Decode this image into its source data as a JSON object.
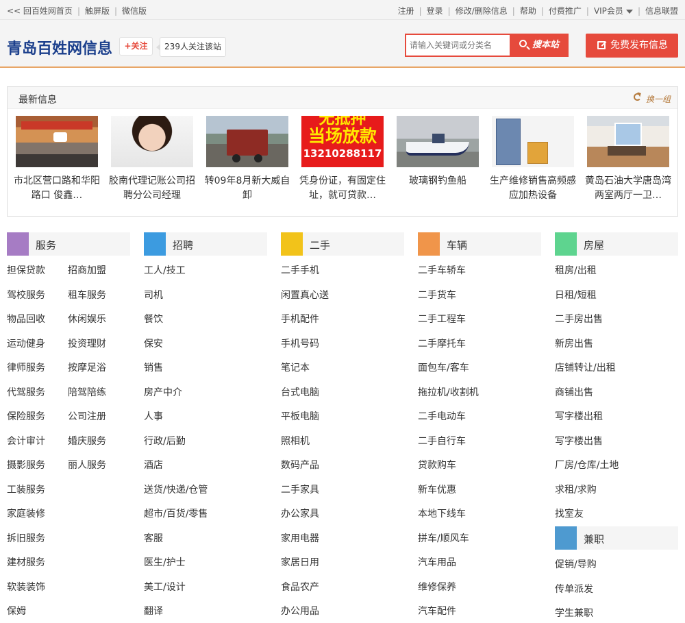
{
  "topbar": {
    "left": [
      {
        "label": "<< 回百姓网首页"
      },
      {
        "label": "触屏版"
      },
      {
        "label": "微信版"
      }
    ],
    "right": [
      {
        "label": "注册"
      },
      {
        "label": "登录"
      },
      {
        "label": "修改/删除信息"
      },
      {
        "label": "帮助"
      },
      {
        "label": "付费推广"
      },
      {
        "label": "VIP会员"
      },
      {
        "label": "信息联盟"
      }
    ]
  },
  "header": {
    "site_title": "青岛百姓网信息",
    "follow_label": "+关注",
    "follow_count": "239人关注该站",
    "search_placeholder": "请输入关键词或分类名",
    "search_button": "搜本站",
    "publish_button": "免费发布信息",
    "accent_color": "#e64a3c"
  },
  "latest": {
    "title": "最新信息",
    "refresh_label": "换一组",
    "items": [
      {
        "caption": "市北区营口路和华阳路口 俊鑫…",
        "image": "storefront-photo"
      },
      {
        "caption": "胶南代理记账公司招聘分公司经理",
        "image": "portrait-photo"
      },
      {
        "caption": "转09年8月新大威自卸",
        "image": "dump-truck-photo"
      },
      {
        "caption": "凭身份证，有固定住址，就可贷款…",
        "image": "loan-ad",
        "ad_lines": [
          "无抵押",
          "当场放款",
          "13210288117"
        ]
      },
      {
        "caption": "玻璃钢钓鱼船",
        "image": "boat-photo"
      },
      {
        "caption": "生产维修销售高频感应加热设备",
        "image": "heater-equipment-photo"
      },
      {
        "caption": "黄岛石油大学唐岛湾两室两厅一卫…",
        "image": "living-room-photo"
      }
    ]
  },
  "categories": [
    {
      "name": "服务",
      "color": "#a67cc4",
      "items": [
        "担保贷款",
        "招商加盟",
        "驾校服务",
        "租车服务",
        "物品回收",
        "休闲娱乐",
        "运动健身",
        "投资理财",
        "律师服务",
        "按摩足浴",
        "代驾服务",
        "陪驾陪练",
        "保险服务",
        "公司注册",
        "会计审计",
        "婚庆服务",
        "摄影服务",
        "丽人服务",
        "工装服务",
        "家庭装修",
        "拆旧服务",
        "建材服务",
        "软装装饰",
        "保姆"
      ]
    },
    {
      "name": "招聘",
      "color": "#3c9be0",
      "items": [
        "工人/技工",
        "司机",
        "餐饮",
        "保安",
        "销售",
        "房产中介",
        "人事",
        "行政/后勤",
        "酒店",
        "送货/快递/仓管",
        "超市/百货/零售",
        "客服",
        "医生/护士",
        "美工/设计",
        "翻译"
      ]
    },
    {
      "name": "二手",
      "color": "#f2c31a",
      "items": [
        "二手手机",
        "闲置真心送",
        "手机配件",
        "手机号码",
        "笔记本",
        "台式电脑",
        "平板电脑",
        "照相机",
        "数码产品",
        "二手家具",
        "办公家具",
        "家用电器",
        "家居日用",
        "食品农产",
        "办公用品"
      ]
    },
    {
      "name": "车辆",
      "color": "#f0954a",
      "items": [
        "二手车轿车",
        "二手货车",
        "二手工程车",
        "二手摩托车",
        "面包车/客车",
        "拖拉机/收割机",
        "二手电动车",
        "二手自行车",
        "贷款购车",
        "新车优惠",
        "本地下线车",
        "拼车/顺风车",
        "汽车用品",
        "维修保养",
        "汽车配件"
      ]
    },
    {
      "name": "房屋",
      "color": "#5ed48f",
      "items": [
        "租房/出租",
        "日租/短租",
        "二手房出售",
        "新房出售",
        "店铺转让/出租",
        "商铺出售",
        "写字楼出租",
        "写字楼出售",
        "厂房/仓库/土地",
        "求租/求购",
        "找室友"
      ]
    },
    {
      "name": "兼职",
      "color": "#4e9ad0",
      "items": [
        "促销/导购",
        "传单派发",
        "学生兼职"
      ]
    }
  ]
}
